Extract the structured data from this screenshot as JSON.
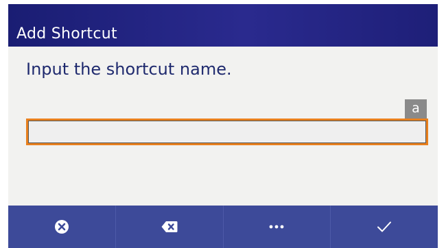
{
  "dialog": {
    "title": "Add Shortcut",
    "prompt": "Input the shortcut name.",
    "input_mode": "a",
    "name_value": ""
  },
  "softkeys": [
    {
      "icon": "cancel-circle-x-icon"
    },
    {
      "icon": "backspace-icon"
    },
    {
      "icon": "more-ellipsis-icon"
    },
    {
      "icon": "confirm-check-icon"
    }
  ],
  "colors": {
    "title_bar": "#22237f",
    "softkey_bar": "#3d4a99",
    "prompt_text": "#1f2a6e",
    "input_focus_border": "#e8801e",
    "input_mode_badge": "#8a8a8a",
    "content_background": "#f2f2f0"
  }
}
